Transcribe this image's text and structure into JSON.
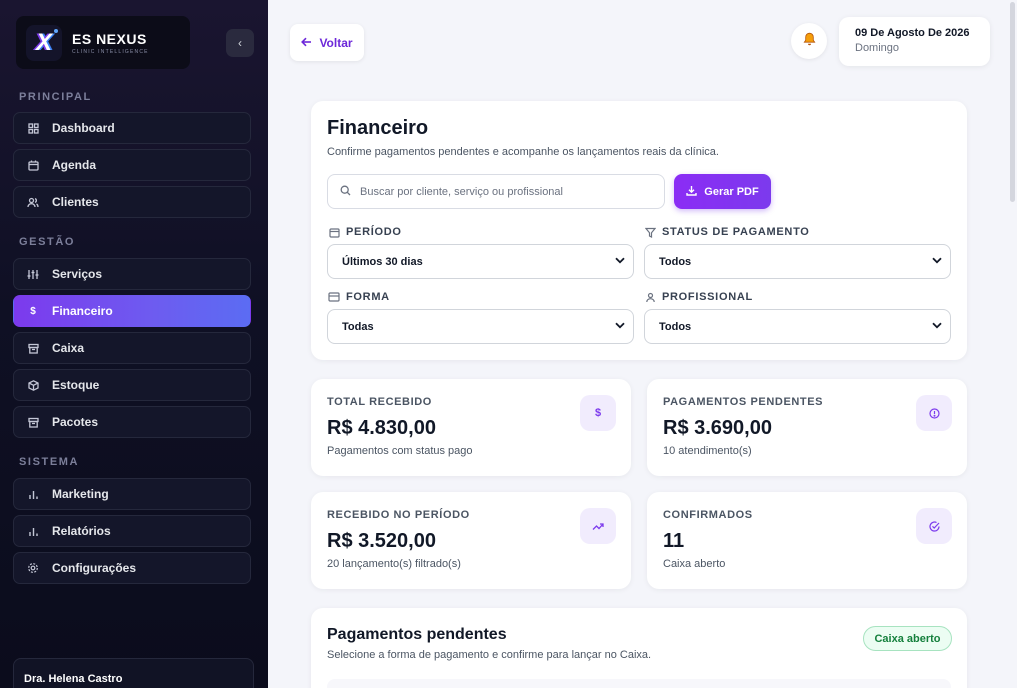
{
  "brand": {
    "name": "ES NEXUS",
    "subtitle": "CLINIC INTELLIGENCE",
    "logo_letter": "X"
  },
  "sidebar": {
    "collapse_icon": "‹",
    "sections": {
      "principal": "PRINCIPAL",
      "gestao": "GESTÃO",
      "sistema": "SISTEMA"
    },
    "items": [
      {
        "label": "Dashboard",
        "icon": "grid-icon"
      },
      {
        "label": "Agenda",
        "icon": "calendar-icon"
      },
      {
        "label": "Clientes",
        "icon": "users-icon"
      },
      {
        "label": "Serviços",
        "icon": "sliders-icon"
      },
      {
        "label": "Financeiro",
        "icon": "dollar-icon",
        "active": true
      },
      {
        "label": "Caixa",
        "icon": "box-icon"
      },
      {
        "label": "Estoque",
        "icon": "package-icon"
      },
      {
        "label": "Pacotes",
        "icon": "archive-icon"
      },
      {
        "label": "Marketing",
        "icon": "bar-chart-icon"
      },
      {
        "label": "Relatórios",
        "icon": "bar-chart-icon"
      },
      {
        "label": "Configurações",
        "icon": "gear-icon"
      }
    ],
    "user": "Dra. Helena Castro"
  },
  "header": {
    "back_label": "Voltar",
    "date": "09 De Agosto De 2026",
    "weekday": "Domingo"
  },
  "financeiro": {
    "title": "Financeiro",
    "subtitle": "Confirme pagamentos pendentes e acompanhe os lançamentos reais da clínica.",
    "search_placeholder": "Buscar por cliente, serviço ou profissional",
    "pdf_label": "Gerar PDF",
    "filters": {
      "periodo": {
        "label": "PERÍODO",
        "value": "Últimos 30 dias"
      },
      "status": {
        "label": "STATUS DE PAGAMENTO",
        "value": "Todos"
      },
      "forma": {
        "label": "FORMA",
        "value": "Todas"
      },
      "profissional": {
        "label": "PROFISSIONAL",
        "value": "Todos"
      }
    }
  },
  "stats": [
    {
      "title": "TOTAL RECEBIDO",
      "value": "R$ 4.830,00",
      "sub": "Pagamentos com status pago",
      "icon": "dollar-icon"
    },
    {
      "title": "PAGAMENTOS PENDENTES",
      "value": "R$ 3.690,00",
      "sub": "10 atendimento(s)",
      "icon": "clock-icon"
    },
    {
      "title": "RECEBIDO NO PERÍODO",
      "value": "R$ 3.520,00",
      "sub": "20 lançamento(s) filtrado(s)",
      "icon": "trend-up-icon"
    },
    {
      "title": "CONFIRMADOS",
      "value": "11",
      "sub": "Caixa aberto",
      "icon": "check-circle-icon"
    }
  ],
  "pendentes": {
    "title": "Pagamentos pendentes",
    "subtitle": "Selecione a forma de pagamento e confirme para lançar no Caixa.",
    "badge": "Caixa aberto"
  },
  "colors": {
    "accent": "#7c3aed",
    "sidebar_bg": "#0f1024",
    "success": "#15803d"
  }
}
